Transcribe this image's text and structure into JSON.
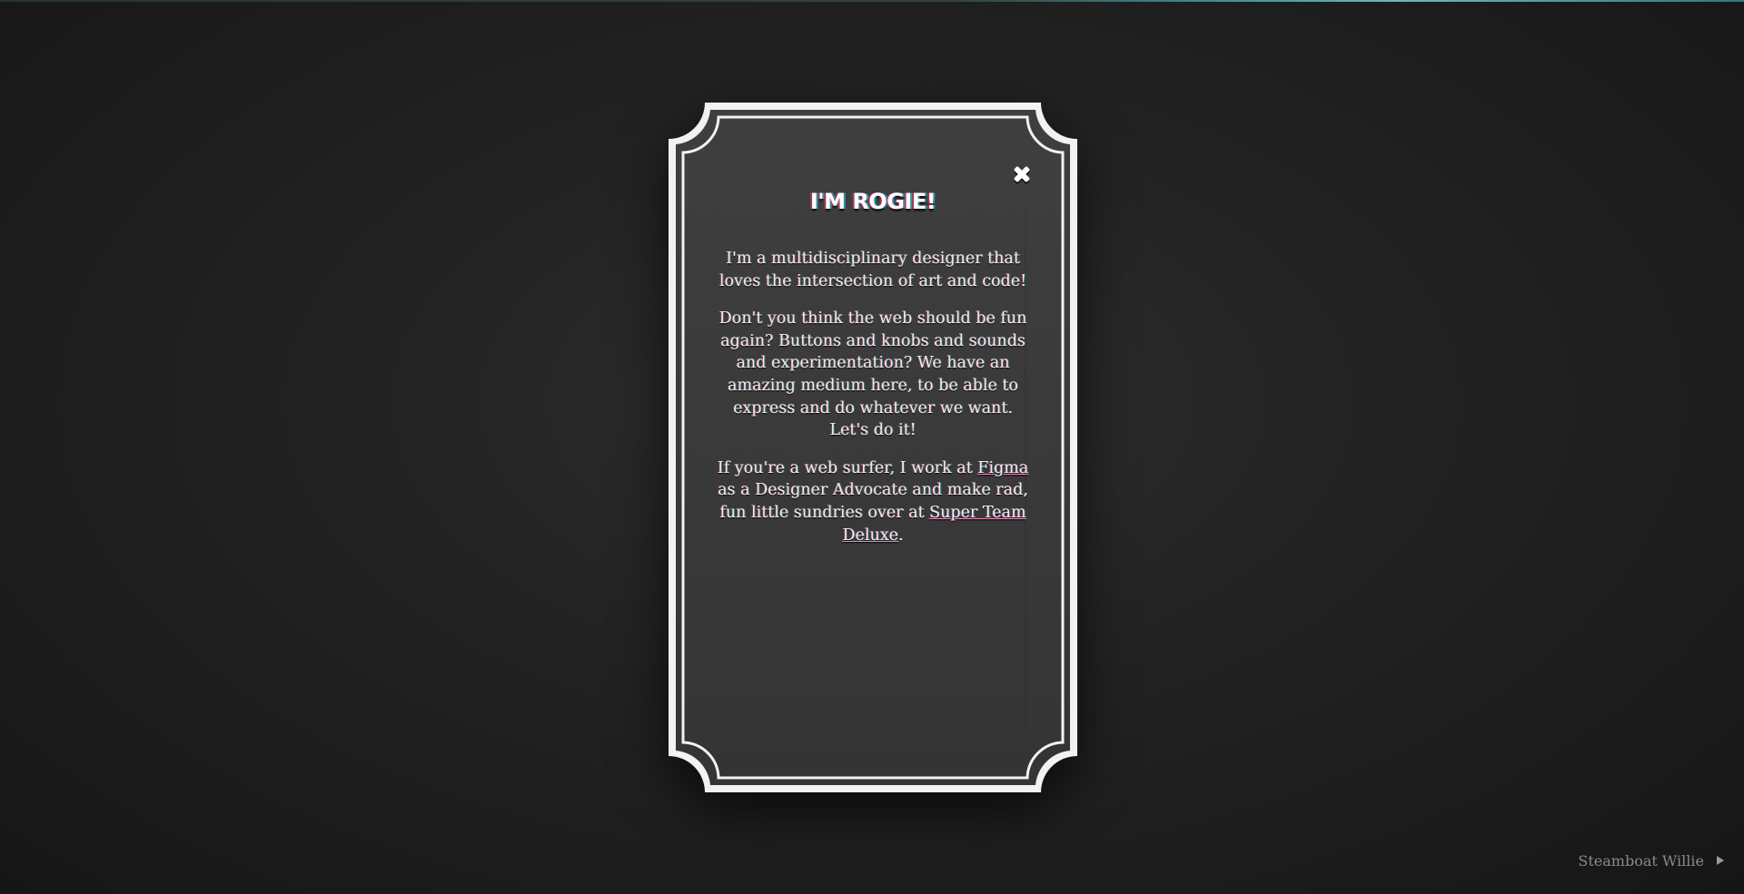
{
  "card": {
    "title": "I'M ROGIE!",
    "paragraph1": "I'm a multidisciplinary designer that loves the intersection of art and code!",
    "paragraph2": "Don't you think the web should be fun again? Buttons and knobs and sounds and experimentation? We have an amazing medium here, to be able to express and do whatever we want. Let's do it!",
    "paragraph3_before_link1": "If you're a web surfer, I work at ",
    "link1": "Figma",
    "paragraph3_between": " as a Designer Advocate and make rad, fun little sundries over at ",
    "link2": "Super Team Deluxe",
    "paragraph3_end": "."
  },
  "icons": {
    "close": "close-icon",
    "play": "play-icon"
  },
  "music": {
    "track_label": "Steamboat Willie"
  },
  "colors": {
    "background": "#1c1c1c",
    "card_fill": "#3a3a3a",
    "card_border": "#f4f4f4",
    "text": "#f1ebe4",
    "link_underline": "#e98fb5"
  }
}
